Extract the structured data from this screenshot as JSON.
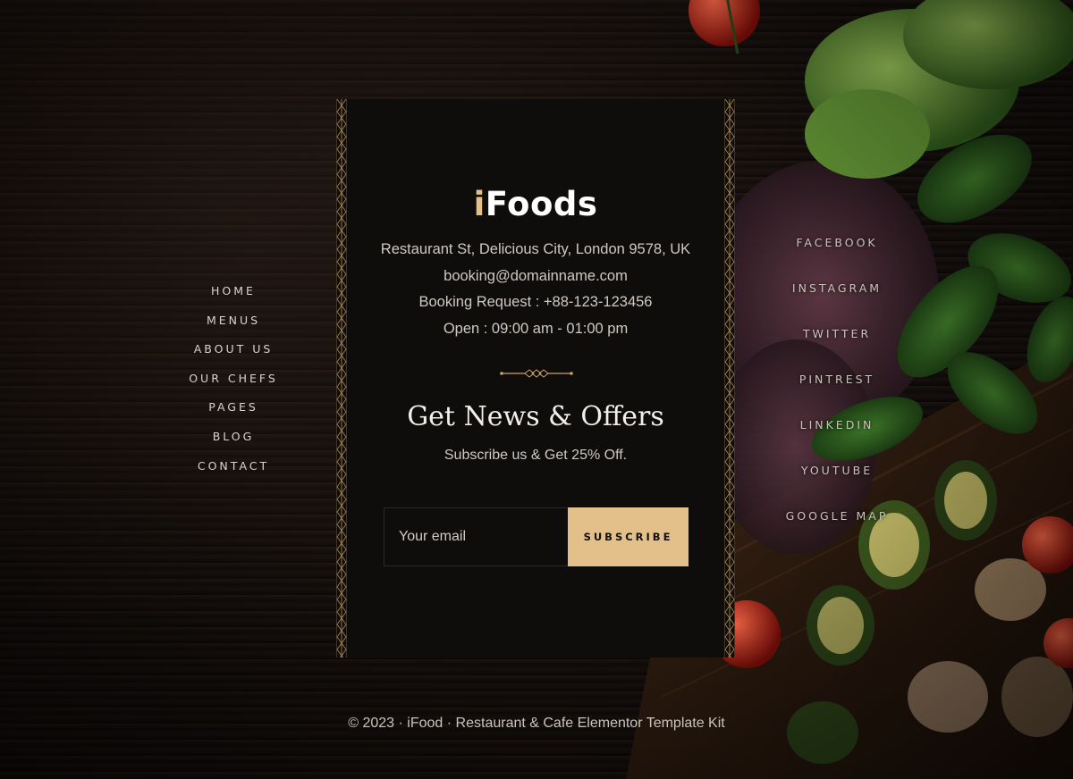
{
  "brand": {
    "accent_letter": "i",
    "name_rest": "Foods"
  },
  "contact": {
    "address": "Restaurant St, Delicious City, London 9578, UK",
    "email": "booking@domainname.com",
    "booking": "Booking Request : +88-123-123456",
    "hours": "Open : 09:00 am - 01:00 pm"
  },
  "newsletter": {
    "title": "Get News & Offers",
    "subtitle": "Subscribe us & Get 25% Off.",
    "email_placeholder": "Your email",
    "button_label": "SUBSCRIBE"
  },
  "nav_left": {
    "items": [
      {
        "label": "HOME"
      },
      {
        "label": "MENUS"
      },
      {
        "label": "ABOUT US"
      },
      {
        "label": "OUR CHEFS"
      },
      {
        "label": "PAGES"
      },
      {
        "label": "BLOG"
      },
      {
        "label": "CONTACT"
      }
    ]
  },
  "nav_right": {
    "items": [
      {
        "label": "FACEBOOK"
      },
      {
        "label": "INSTAGRAM"
      },
      {
        "label": "TWITTER"
      },
      {
        "label": "PINTREST"
      },
      {
        "label": "LINKEDIN"
      },
      {
        "label": "YOUTUBE"
      },
      {
        "label": "GOOGLE MAP"
      }
    ]
  },
  "footer": {
    "copyright": "© 2023 · iFood · Restaurant & Cafe Elementor Template Kit"
  },
  "colors": {
    "accent": "#e3c08a",
    "card": "#0f0d0c",
    "text": "#cfc9c2"
  },
  "icons": {
    "divider": "ornament-divider-icon",
    "border": "art-deco-border-pattern"
  }
}
